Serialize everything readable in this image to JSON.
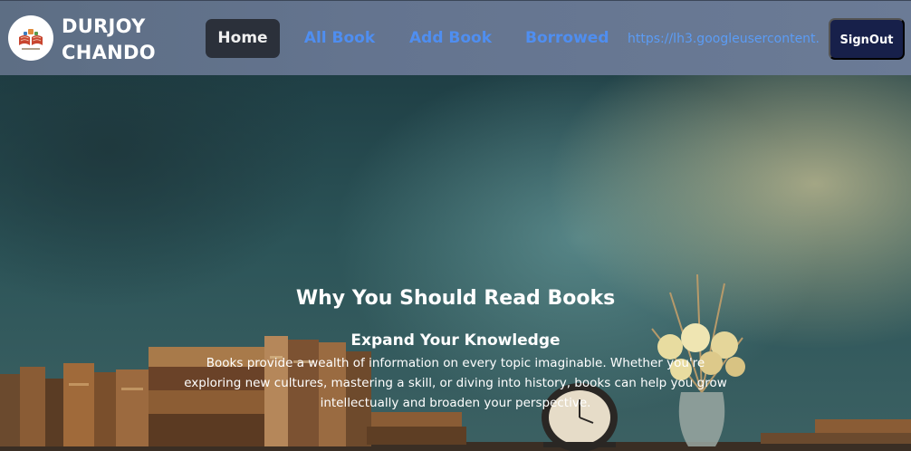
{
  "navbar": {
    "brand_line1": "DURJOY",
    "brand_line2": "CHANDO",
    "logo_icon": "open-book-logo",
    "links": {
      "home": "Home",
      "all_book": "All Book",
      "add_book": "Add Book",
      "borrowed": "Borrowed"
    },
    "active_link": "Home",
    "user_photo_url": "https://lh3.googleusercontent.",
    "signout_label": "SignOut",
    "colors": {
      "link": "#4f8ef0",
      "active_bg": "#2b303a",
      "signout_bg": "#17204a"
    }
  },
  "hero": {
    "title": "Why You Should Read Books",
    "subtitle": "Expand Your Knowledge",
    "text": "Books provide a wealth of information on every topic imaginable. Whether you're exploring new cultures, mastering a skill, or diving into history, books can help you grow intellectually and broaden your perspective.",
    "background_image": "books-on-shelf-with-clock-and-flowers"
  }
}
